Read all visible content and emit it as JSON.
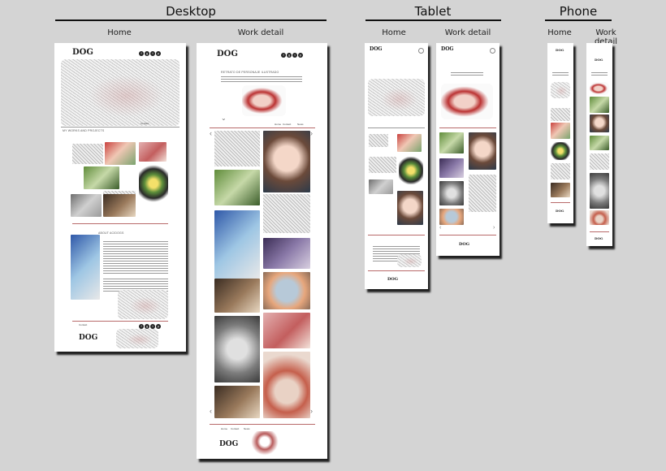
{
  "groups": {
    "desktop": "Desktop",
    "tablet": "Tablet",
    "phone": "Phone"
  },
  "columns": {
    "desktop_home": "Home",
    "desktop_work": "Work detail",
    "tablet_home": "Home",
    "tablet_work": "Work detail",
    "phone_home": "Home",
    "phone_work": "Work detail"
  },
  "logo": "DOG",
  "mock_text": {
    "projects_heading": "MY WORKS AND PROJECTS",
    "about_heading": "ABOUT ACIDOGS",
    "work_title": "RETRATO DE PERSONAJE ILUSTRADO",
    "nav_home": "Home",
    "nav_contact": "Contact",
    "nav_news": "News",
    "contact": "Contact"
  },
  "colors": {
    "background": "#d4d4d4",
    "accent_rule": "#b86a6a",
    "shadow": "#000000"
  },
  "icons": [
    "facebook-icon",
    "googleplus-icon",
    "twitter-icon",
    "pinterest-icon"
  ]
}
